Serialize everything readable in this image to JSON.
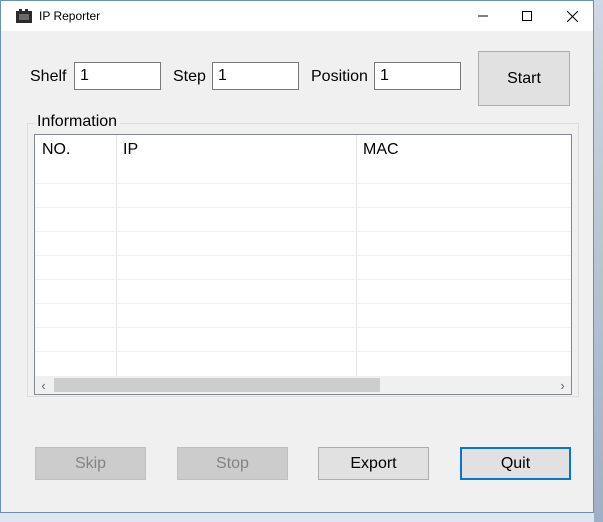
{
  "window": {
    "title": "IP Reporter",
    "icons": {
      "app": "app-icon",
      "minimize": "minimize-icon",
      "maximize": "maximize-icon",
      "close": "close-icon"
    }
  },
  "inputs": {
    "shelf": {
      "label": "Shelf",
      "value": "1"
    },
    "step": {
      "label": "Step",
      "value": "1"
    },
    "position": {
      "label": "Position",
      "value": "1"
    }
  },
  "buttons": {
    "start": "Start",
    "skip": "Skip",
    "stop": "Stop",
    "export": "Export",
    "quit": "Quit"
  },
  "information": {
    "title": "Information",
    "columns": [
      "NO.",
      "IP",
      "MAC"
    ],
    "rows": []
  },
  "scrollbar": {
    "left_icon": "chevron-left-icon",
    "right_icon": "chevron-right-icon",
    "left_glyph": "‹",
    "right_glyph": "›"
  },
  "colors": {
    "accent": "#0078d7",
    "window_border": "#6b8fb8"
  }
}
